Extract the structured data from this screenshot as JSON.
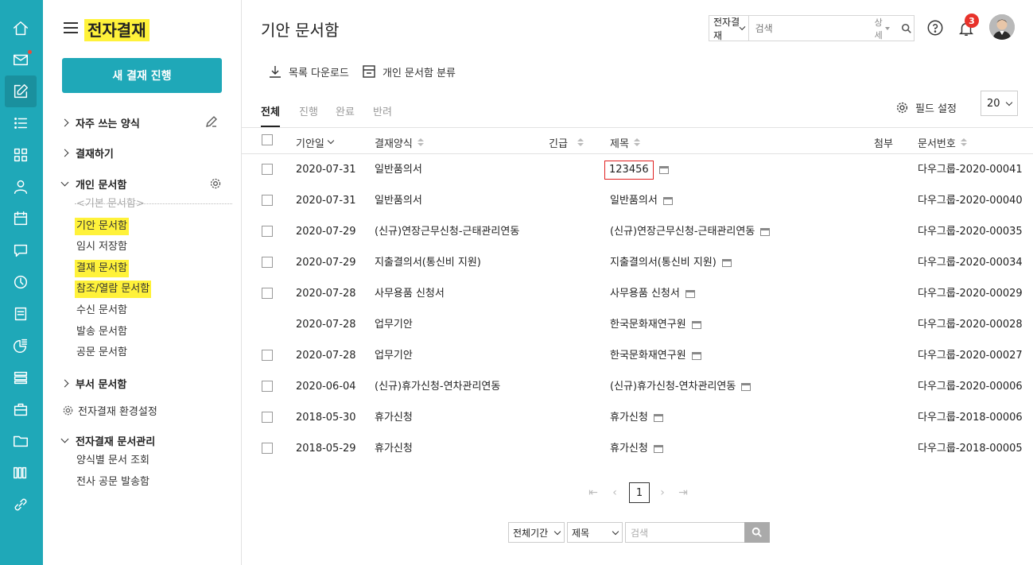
{
  "rail": {
    "items": [
      {
        "name": "home-icon"
      },
      {
        "name": "mail-icon"
      },
      {
        "name": "approval-icon"
      },
      {
        "name": "list-icon"
      },
      {
        "name": "grid-icon"
      },
      {
        "name": "contact-icon"
      },
      {
        "name": "calendar-icon"
      },
      {
        "name": "chat-icon"
      },
      {
        "name": "clock-icon"
      },
      {
        "name": "board-icon"
      },
      {
        "name": "report-icon"
      },
      {
        "name": "database-icon"
      },
      {
        "name": "briefcase-icon"
      },
      {
        "name": "folder-icon"
      },
      {
        "name": "books-icon"
      },
      {
        "name": "link-icon"
      }
    ]
  },
  "sidebar": {
    "app_title": "전자결재",
    "new_button": "새 결재 진행",
    "groups": {
      "favorites": "자주 쓰는 양식",
      "approve": "결재하기",
      "personal": "개인 문서함",
      "dept": "부서 문서함",
      "manage": "전자결재 문서관리"
    },
    "personal_items": {
      "default_box": "<기본 문서함>",
      "drafts": "기안 문서함",
      "temp": "임시 저장함",
      "approved": "결재 문서함",
      "reference": "참조/열람 문서함",
      "received": "수신 문서함",
      "sent": "발송 문서함",
      "official": "공문 문서함"
    },
    "settings": "전자결재 환경설정",
    "manage_items": {
      "by_form": "양식별 문서 조회",
      "company_send": "전사 공문 발송함"
    }
  },
  "header": {
    "page_title": "기안 문서함",
    "search_scope": "전자결재",
    "search_placeholder": "검색",
    "search_detail": "상세",
    "notification_count": "3"
  },
  "toolbar": {
    "download": "목록 다운로드",
    "classify": "개인 문서함 분류",
    "field_settings": "필드 설정",
    "page_size": "20"
  },
  "tabs": {
    "all": "전체",
    "progress": "진행",
    "done": "완료",
    "rejected": "반려"
  },
  "table": {
    "headers": {
      "date": "기안일",
      "form": "결재양식",
      "urgent": "긴급",
      "title": "제목",
      "attach": "첨부",
      "docno": "문서번호"
    },
    "rows": [
      {
        "date": "2020-07-31",
        "form": "일반품의서",
        "title": "123456",
        "docno": "다우그룹-2020-00041",
        "checkbox": true,
        "highlight": true
      },
      {
        "date": "2020-07-31",
        "form": "일반품의서",
        "title": "일반품의서",
        "docno": "다우그룹-2020-00040",
        "checkbox": true
      },
      {
        "date": "2020-07-29",
        "form": "(신규)연장근무신청-근태관리연동",
        "title": "(신규)연장근무신청-근태관리연동",
        "docno": "다우그룹-2020-00035",
        "checkbox": true
      },
      {
        "date": "2020-07-29",
        "form": "지출결의서(통신비 지원)",
        "title": "지출결의서(통신비 지원)",
        "docno": "다우그룹-2020-00034",
        "checkbox": true
      },
      {
        "date": "2020-07-28",
        "form": "사무용품 신청서",
        "title": "사무용품 신청서",
        "docno": "다우그룹-2020-00029",
        "checkbox": true
      },
      {
        "date": "2020-07-28",
        "form": "업무기안",
        "title": "한국문화재연구원",
        "docno": "다우그룹-2020-00028",
        "checkbox": false
      },
      {
        "date": "2020-07-28",
        "form": "업무기안",
        "title": "한국문화재연구원",
        "docno": "다우그룹-2020-00027",
        "checkbox": true
      },
      {
        "date": "2020-06-04",
        "form": "(신규)휴가신청-연차관리연동",
        "title": "(신규)휴가신청-연차관리연동",
        "docno": "다우그룹-2020-00006",
        "checkbox": true
      },
      {
        "date": "2018-05-30",
        "form": "휴가신청",
        "title": "휴가신청",
        "docno": "다우그룹-2018-00006",
        "checkbox": true
      },
      {
        "date": "2018-05-29",
        "form": "휴가신청",
        "title": "휴가신청",
        "docno": "다우그룹-2018-00005",
        "checkbox": true
      }
    ]
  },
  "pagination": {
    "current": "1"
  },
  "bottom_search": {
    "period": "전체기간",
    "field": "제목",
    "placeholder": "검색"
  },
  "colors": {
    "accent": "#1fa8b8",
    "highlight": "#fff23a",
    "badge": "#e8322a",
    "selection_border": "#e02020"
  }
}
